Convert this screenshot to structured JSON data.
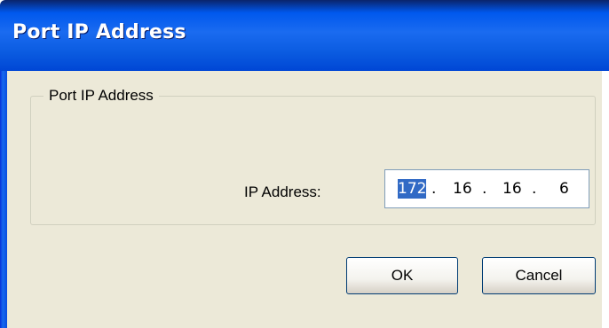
{
  "window": {
    "title": "Port IP Address"
  },
  "group": {
    "legend": "Port IP Address"
  },
  "ip_field": {
    "label": "IP Address:",
    "octets": [
      "172",
      "16",
      "16",
      "6"
    ],
    "separator": ".",
    "selected_octet": "172"
  },
  "buttons": {
    "ok_label": "OK",
    "cancel_label": "Cancel"
  },
  "colors": {
    "titlebar": "#0058ee",
    "dialog_bg": "#ece9d8",
    "selection": "#316ac5"
  }
}
